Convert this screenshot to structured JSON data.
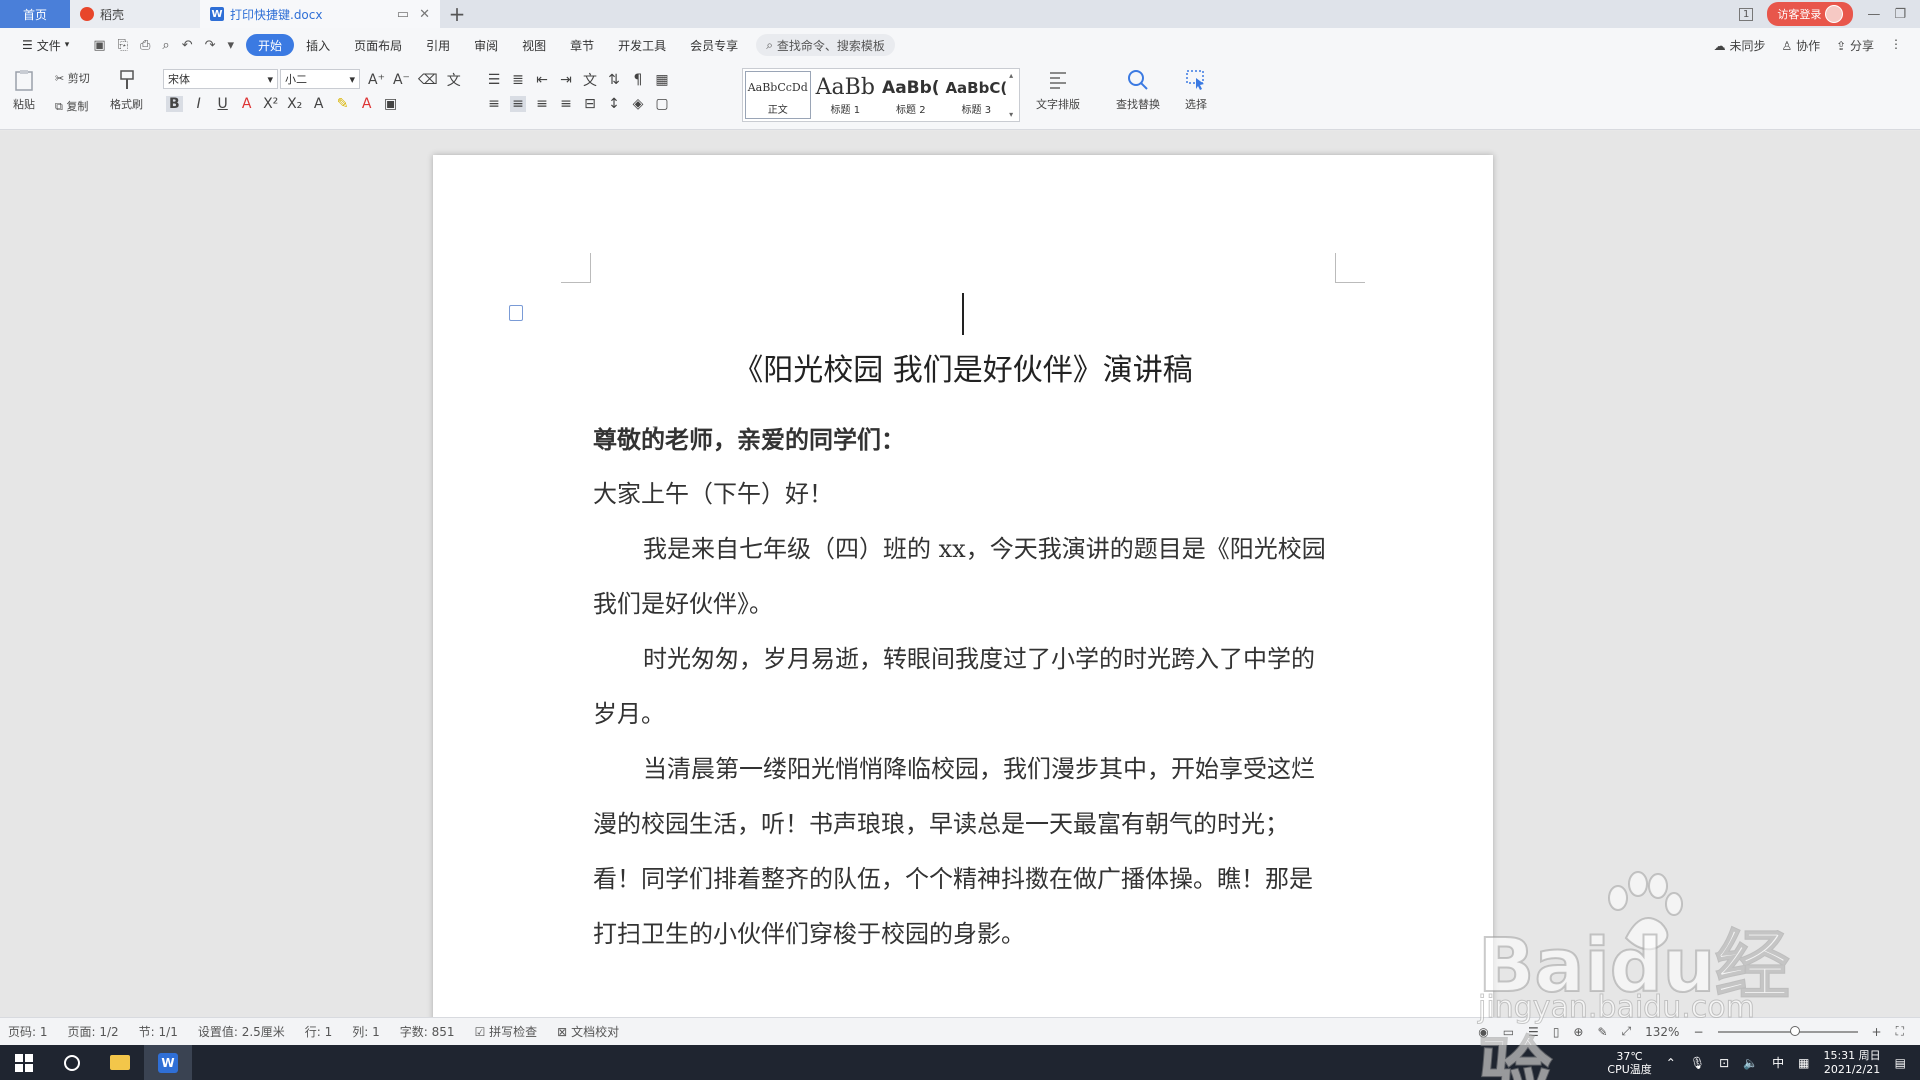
{
  "tabs": {
    "home": "首页",
    "daoke": "稻壳",
    "doc": "打印快捷键.docx",
    "visitor": "访客登录",
    "page_indicator": "1"
  },
  "menu": {
    "file": "文件",
    "items": [
      "开始",
      "插入",
      "页面布局",
      "引用",
      "审阅",
      "视图",
      "章节",
      "开发工具",
      "会员专享"
    ],
    "search": "查找命令、搜索模板",
    "sync": "未同步",
    "collab": "协作",
    "share": "分享"
  },
  "ribbon": {
    "paste": "粘贴",
    "cut": "剪切",
    "copy": "复制",
    "format_painter": "格式刷",
    "font_name": "宋体",
    "font_size": "小二",
    "styles": [
      {
        "preview": "AaBbCcDd",
        "label": "正文"
      },
      {
        "preview": "AaBb",
        "label": "标题 1"
      },
      {
        "preview": "AaBb(",
        "label": "标题 2"
      },
      {
        "preview": "AaBbC(",
        "label": "标题 3"
      }
    ],
    "text_layout": "文字排版",
    "find_replace": "查找替换",
    "select": "选择"
  },
  "document": {
    "title": "《阳光校园  我们是好伙伴》演讲稿",
    "salutation": "尊敬的老师，亲爱的同学们：",
    "greeting": "大家上午（下午）好！",
    "p1": "我是来自七年级（四）班的 xx，今天我演讲的题目是《阳光校园  我们是好伙伴》。",
    "p2": "时光匆匆，岁月易逝，转眼间我度过了小学的时光跨入了中学的岁月。",
    "p3": "当清晨第一缕阳光悄悄降临校园，我们漫步其中，开始享受这烂漫的校园生活，听！书声琅琅，早读总是一天最富有朝气的时光；看！同学们排着整齐的队伍，个个精神抖擞在做广播体操。瞧！那是打扫卫生的小伙伴们穿梭于校园的身影。"
  },
  "status": {
    "page_code": "页码: 1",
    "page": "页面: 1/2",
    "section": "节: 1/1",
    "setting": "设置值: 2.5厘米",
    "row": "行: 1",
    "col": "列: 1",
    "words": "字数: 851",
    "spell": "拼写检查",
    "proof": "文档校对",
    "zoom": "132%"
  },
  "taskbar": {
    "temp": "37℃",
    "cpu": "CPU温度",
    "ime": "中",
    "time": "15:31 周日",
    "date": "2021/2/21"
  },
  "watermark": {
    "brand": "Baidu经验",
    "url": "jingyan.baidu.com"
  },
  "colors": {
    "accent": "#3b7ae2",
    "visitor": "#e8564b",
    "taskbar": "#1f2530"
  }
}
